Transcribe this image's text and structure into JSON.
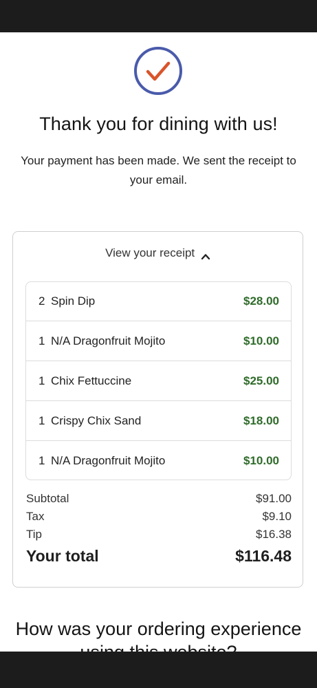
{
  "header": {
    "title": "Thank you for dining with us!",
    "subtitle": "Your payment has been made. We sent the receipt to your email.",
    "check_icon": "checkmark-circle-icon"
  },
  "receipt": {
    "toggle_label": "View your receipt",
    "toggle_icon": "chevron-up-icon",
    "items": [
      {
        "qty": "2",
        "name": "Spin Dip",
        "price": "$28.00"
      },
      {
        "qty": "1",
        "name": "N/A Dragonfruit Mojito",
        "price": "$10.00"
      },
      {
        "qty": "1",
        "name": "Chix Fettuccine",
        "price": "$25.00"
      },
      {
        "qty": "1",
        "name": "Crispy Chix Sand",
        "price": "$18.00"
      },
      {
        "qty": "1",
        "name": "N/A Dragonfruit Mojito",
        "price": "$10.00"
      }
    ],
    "subtotal_label": "Subtotal",
    "subtotal_value": "$91.00",
    "tax_label": "Tax",
    "tax_value": "$9.10",
    "tip_label": "Tip",
    "tip_value": "$16.38",
    "total_label": "Your total",
    "total_value": "$116.48"
  },
  "feedback": {
    "heading": "How was your ordering experience using this website?"
  },
  "colors": {
    "check_circle": "#4a5bab",
    "check_mark": "#d9542b",
    "price_green": "#2f6b2a",
    "system_bar": "#1c1c1c"
  }
}
